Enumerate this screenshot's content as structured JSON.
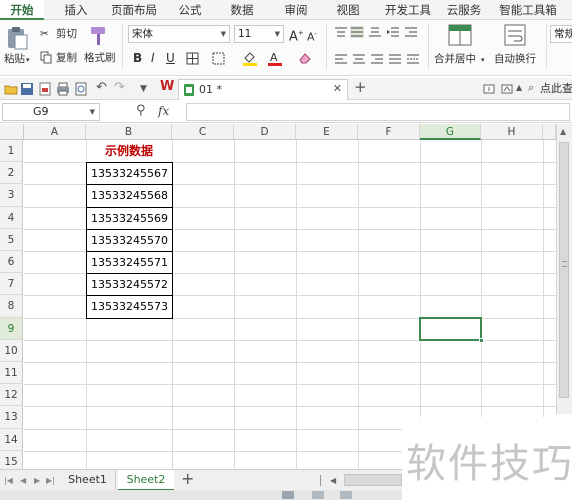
{
  "menu": {
    "tabs": [
      "开始",
      "插入",
      "页面布局",
      "公式",
      "数据",
      "审阅",
      "视图",
      "开发工具",
      "云服务",
      "智能工具箱"
    ],
    "active": "开始"
  },
  "ribbon": {
    "paste_label": "粘贴",
    "cut_label": "剪切",
    "copy_label": "复制",
    "format_painter_label": "格式刷",
    "font_name": "宋体",
    "font_size": "11",
    "merge_center_label": "合并居中",
    "wrap_text_label": "自动换行",
    "number_format_label": "常规",
    "accent_color": "#3c8a4f",
    "font_color": "#e02020",
    "fill_color": "#ffd800"
  },
  "quickbar": {
    "document_tab": "01 *",
    "find_label": "点此查"
  },
  "formula_bar": {
    "name_box": "G9",
    "fx": "fx",
    "content": ""
  },
  "grid": {
    "columns": [
      "A",
      "B",
      "C",
      "D",
      "E",
      "F",
      "G",
      "H"
    ],
    "rows": [
      "1",
      "2",
      "3",
      "4",
      "5",
      "6",
      "7",
      "8",
      "9",
      "10",
      "11",
      "12",
      "13",
      "14",
      "15"
    ],
    "selected_cell": "G9",
    "title": "示例数据",
    "title_color": "#c00000",
    "values": [
      "13533245567",
      "13533245568",
      "13533245569",
      "13533245570",
      "13533245571",
      "13533245572",
      "13533245573"
    ]
  },
  "sheets": {
    "tabs": [
      "Sheet1",
      "Sheet2"
    ],
    "active": "Sheet2"
  },
  "watermark": "软件技巧"
}
